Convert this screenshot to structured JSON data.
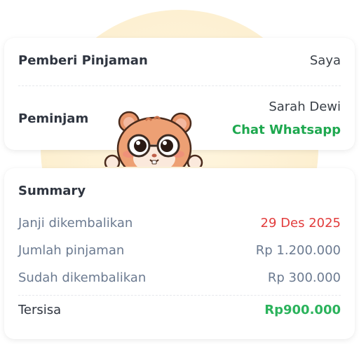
{
  "lender": {
    "label": "Pemberi Pinjaman",
    "value": "Saya"
  },
  "borrower": {
    "label": "Peminjam",
    "name": "Sarah Dewi",
    "action": "Chat Whatsapp"
  },
  "summary": {
    "title": "Summary",
    "rows": [
      {
        "label": "Janji dikembalikan",
        "value": "29 Des 2025"
      },
      {
        "label": "Jumlah pinjaman",
        "value": "Rp 1.200.000"
      },
      {
        "label": "Sudah dikembalikan",
        "value": "Rp 300.000"
      }
    ],
    "total": {
      "label": "Tersisa",
      "value": "Rp900.000"
    }
  },
  "colors": {
    "accent_green": "#1ea84f",
    "due_red": "#e23c3c",
    "glow": "#fdf0d2"
  },
  "mascot": {
    "icon": "hamster-with-glasses-illustration"
  }
}
